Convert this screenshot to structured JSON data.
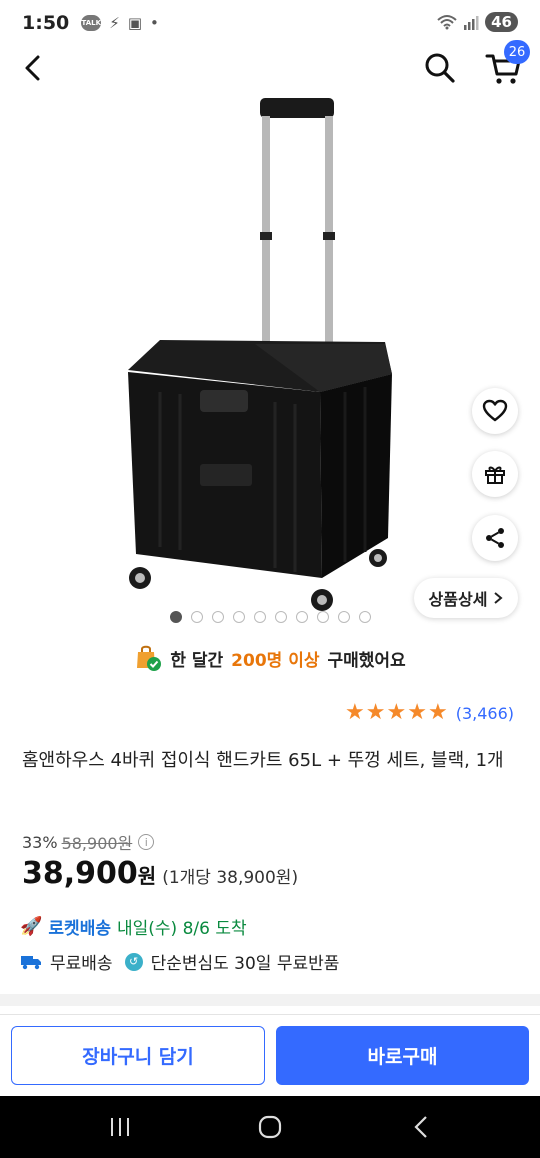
{
  "status_bar": {
    "time": "1:50",
    "talk_badge": "TALK",
    "battery": "46"
  },
  "header": {
    "back_icon": "chevron-left-icon",
    "search_icon": "search-icon",
    "cart_icon": "cart-icon",
    "cart_count": "26"
  },
  "side_actions": {
    "wishlist_icon": "heart-icon",
    "gift_icon": "gift-icon",
    "share_icon": "share-icon",
    "detail_label": "상품상세"
  },
  "carousel": {
    "total": 10,
    "active_index": 0
  },
  "purchase_banner": {
    "prefix": "한 달간",
    "highlight": "200명 이상",
    "suffix": "구매했어요"
  },
  "rating": {
    "stars": 5,
    "review_count": "(3,466)"
  },
  "product": {
    "title": "홈앤하우스 4바퀴 접이식 핸드카트 65L + 뚜껑 세트, 블랙, 1개",
    "discount_rate": "33%",
    "original_price": "58,900원",
    "sale_price": "38,900",
    "sale_currency": "원",
    "unit_price": "(1개당 38,900원)"
  },
  "delivery": {
    "rocket_label": "로켓배송",
    "rocket_eta": "내일(수) 8/6 도착",
    "free_shipping": "무료배송",
    "free_return": "단순변심도 30일 무료반품"
  },
  "bottom_bar": {
    "add_to_cart": "장바구니 담기",
    "buy_now": "바로구매"
  },
  "colors": {
    "accent": "#346aff",
    "purchase_highlight": "#e8760a",
    "star": "#f5892a",
    "rocket_green": "#0a8a3f"
  }
}
